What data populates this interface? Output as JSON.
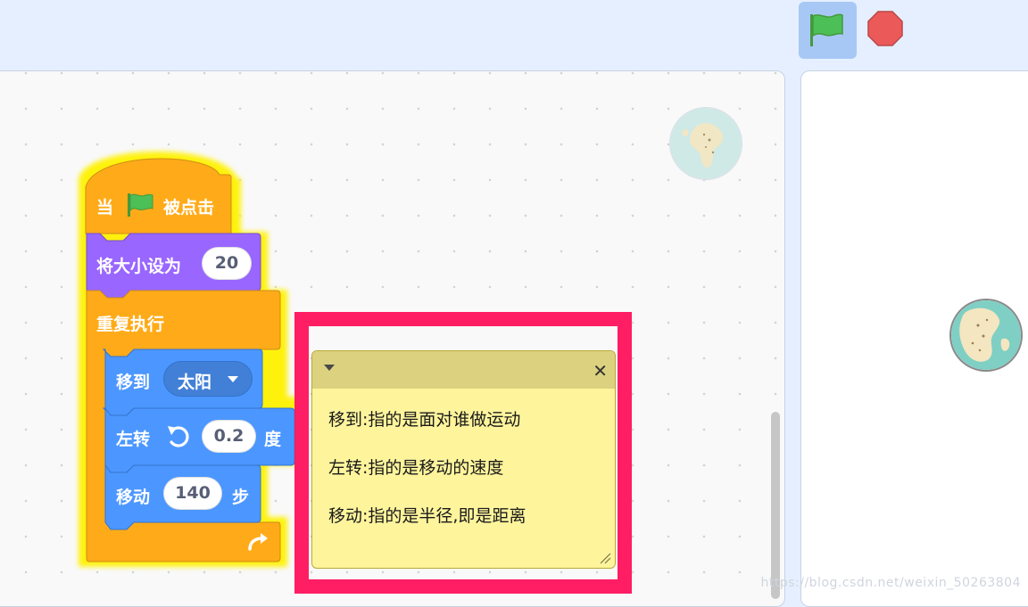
{
  "toolbar": {
    "flag_icon": "green-flag-icon",
    "stop_icon": "stop-sign-icon",
    "flag_color": "#4cbf56",
    "stop_color": "#ec5959"
  },
  "script": {
    "hat": {
      "prefix": "当",
      "suffix": "被点击",
      "color": "#ffab19"
    },
    "set_size": {
      "label": "将大小设为",
      "value": "20",
      "color": "#9966ff"
    },
    "forever": {
      "label": "重复执行",
      "color": "#ffab19"
    },
    "goto": {
      "label": "移到",
      "target": "太阳",
      "color": "#4c97ff"
    },
    "turn_left": {
      "label": "左转",
      "value": "0.2",
      "unit": "度"
    },
    "move": {
      "label": "移动",
      "value": "140",
      "unit": "步"
    }
  },
  "comment": {
    "lines": [
      "移到:指的是面对谁做运动",
      "左转:指的是移动的速度",
      "移动:指的是半径,即是距离"
    ],
    "highlight_color": "#ff1d64",
    "note_color": "#fef49c"
  },
  "watermark": "https://blog.csdn.net/weixin_50263804"
}
